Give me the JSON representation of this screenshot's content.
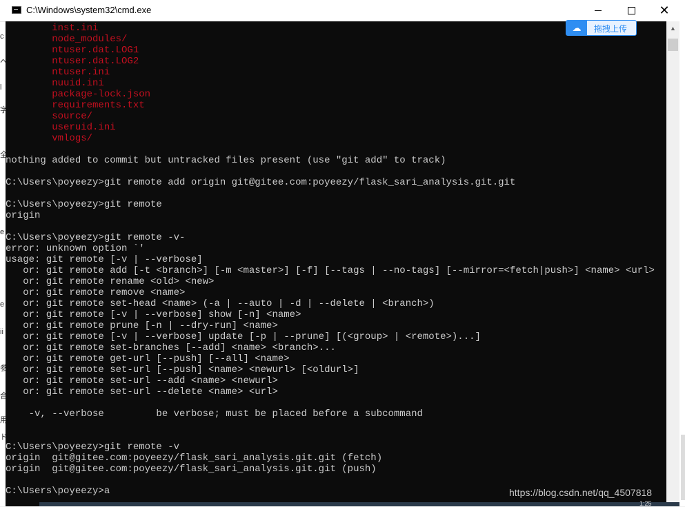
{
  "window": {
    "title": "C:\\Windows\\system32\\cmd.exe",
    "icon": "console-icon",
    "buttons": {
      "minimize": "minimize-icon",
      "maximize": "maximize-icon",
      "close": "close-icon"
    }
  },
  "upload_widget": {
    "label": "拖拽上传",
    "icon": "cloud-icon"
  },
  "background_page": {
    "fragments": [
      "c",
      "へ",
      "l",
      "字",
      "全",
      "e",
      "e",
      "ii",
      "参",
      "合",
      "用",
      "ド"
    ]
  },
  "console": {
    "colors": {
      "text": "#cccccc",
      "untracked": "#c50f1f",
      "background": "#0c0c0c"
    },
    "lines": [
      {
        "text": "        inst.ini",
        "color": "red"
      },
      {
        "text": "        node_modules/",
        "color": "red"
      },
      {
        "text": "        ntuser.dat.LOG1",
        "color": "red"
      },
      {
        "text": "        ntuser.dat.LOG2",
        "color": "red"
      },
      {
        "text": "        ntuser.ini",
        "color": "red"
      },
      {
        "text": "        nuuid.ini",
        "color": "red"
      },
      {
        "text": "        package-lock.json",
        "color": "red"
      },
      {
        "text": "        requirements.txt",
        "color": "red"
      },
      {
        "text": "        source/",
        "color": "red"
      },
      {
        "text": "        useruid.ini",
        "color": "red"
      },
      {
        "text": "        vmlogs/",
        "color": "red"
      },
      {
        "text": "",
        "color": "default"
      },
      {
        "text": "nothing added to commit but untracked files present (use \"git add\" to track)",
        "color": "default"
      },
      {
        "text": "",
        "color": "default"
      },
      {
        "text": "C:\\Users\\poyeezy>git remote add origin git@gitee.com:poyeezy/flask_sari_analysis.git.git",
        "color": "default"
      },
      {
        "text": "",
        "color": "default"
      },
      {
        "text": "C:\\Users\\poyeezy>git remote",
        "color": "default"
      },
      {
        "text": "origin",
        "color": "default"
      },
      {
        "text": "",
        "color": "default"
      },
      {
        "text": "C:\\Users\\poyeezy>git remote -v-",
        "color": "default"
      },
      {
        "text": "error: unknown option `'",
        "color": "default"
      },
      {
        "text": "usage: git remote [-v | --verbose]",
        "color": "default"
      },
      {
        "text": "   or: git remote add [-t <branch>] [-m <master>] [-f] [--tags | --no-tags] [--mirror=<fetch|push>] <name> <url>",
        "color": "default"
      },
      {
        "text": "   or: git remote rename <old> <new>",
        "color": "default"
      },
      {
        "text": "   or: git remote remove <name>",
        "color": "default"
      },
      {
        "text": "   or: git remote set-head <name> (-a | --auto | -d | --delete | <branch>)",
        "color": "default"
      },
      {
        "text": "   or: git remote [-v | --verbose] show [-n] <name>",
        "color": "default"
      },
      {
        "text": "   or: git remote prune [-n | --dry-run] <name>",
        "color": "default"
      },
      {
        "text": "   or: git remote [-v | --verbose] update [-p | --prune] [(<group> | <remote>)...]",
        "color": "default"
      },
      {
        "text": "   or: git remote set-branches [--add] <name> <branch>...",
        "color": "default"
      },
      {
        "text": "   or: git remote get-url [--push] [--all] <name>",
        "color": "default"
      },
      {
        "text": "   or: git remote set-url [--push] <name> <newurl> [<oldurl>]",
        "color": "default"
      },
      {
        "text": "   or: git remote set-url --add <name> <newurl>",
        "color": "default"
      },
      {
        "text": "   or: git remote set-url --delete <name> <url>",
        "color": "default"
      },
      {
        "text": "",
        "color": "default"
      },
      {
        "text": "    -v, --verbose         be verbose; must be placed before a subcommand",
        "color": "default"
      },
      {
        "text": "",
        "color": "default"
      },
      {
        "text": "",
        "color": "default"
      },
      {
        "text": "C:\\Users\\poyeezy>git remote -v",
        "color": "default"
      },
      {
        "text": "origin  git@gitee.com:poyeezy/flask_sari_analysis.git.git (fetch)",
        "color": "default"
      },
      {
        "text": "origin  git@gitee.com:poyeezy/flask_sari_analysis.git.git (push)",
        "color": "default"
      },
      {
        "text": "",
        "color": "default"
      },
      {
        "text": "C:\\Users\\poyeezy>a",
        "color": "default"
      }
    ]
  },
  "watermark": "https://blog.csdn.net/qq_4507818",
  "taskbar": {
    "tray_text": "1:25"
  }
}
